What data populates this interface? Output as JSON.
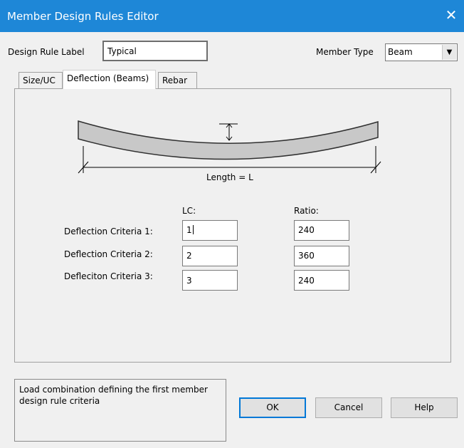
{
  "window": {
    "title": "Member Design Rules Editor",
    "close_glyph": "✕"
  },
  "header": {
    "design_rule_label": "Design Rule Label",
    "design_rule_value": "Typical",
    "member_type_label": "Member Type",
    "member_type_value": "Beam"
  },
  "tabs": [
    {
      "label": "Size/UC",
      "active": false
    },
    {
      "label": "Deflection (Beams)",
      "active": true
    },
    {
      "label": "Rebar",
      "active": false
    }
  ],
  "diagram": {
    "length_label": "Length = L"
  },
  "criteria": {
    "lc_header": "LC:",
    "ratio_header": "Ratio:",
    "rows": [
      {
        "label": "Deflection Criteria 1:",
        "lc": "1",
        "ratio": "240"
      },
      {
        "label": "Deflection Criteria 2:",
        "lc": "2",
        "ratio": "360"
      },
      {
        "label": "Defleciton Criteria 3:",
        "lc": "3",
        "ratio": "240"
      }
    ]
  },
  "status_text": "Load combination defining the first member design rule criteria",
  "buttons": {
    "ok": "OK",
    "cancel": "Cancel",
    "help": "Help"
  },
  "colors": {
    "titlebar": "#1e87d7",
    "dialog_bg": "#f0f0f0",
    "beam_fill": "#c8c8c8"
  }
}
